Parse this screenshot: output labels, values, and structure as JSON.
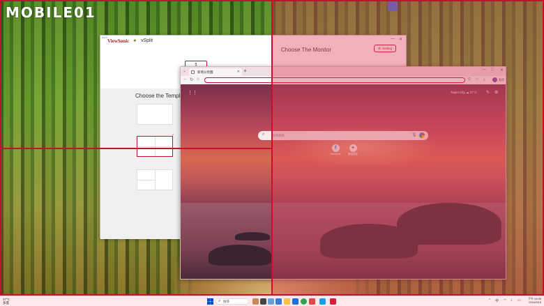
{
  "watermark": {
    "text": "MOBILE01"
  },
  "vsplit": {
    "brand": "ViewSonic",
    "app_name": "vSplit",
    "version": "v1.0",
    "choose_monitor": "Choose The Monitor",
    "setting_label": "Setting",
    "monitor_number": "1",
    "choose_template": "Choose the Templat",
    "minimize": "—",
    "close": "✕"
  },
  "browser": {
    "tab_title": "新增分頁籤",
    "weather_city": "Taipei City",
    "weather_temp": "27°C",
    "search_placeholder": "搜尋網頁",
    "shortcuts": [
      {
        "label": "Facebook",
        "icon": "f"
      },
      {
        "label": "新增捷徑",
        "icon": "+"
      }
    ],
    "profile_label": "暫停"
  },
  "taskbar": {
    "weather_temp": "27°C",
    "weather_desc": "多雲",
    "search_label": "搜尋",
    "time": "下午 04:35",
    "date": "2024/5/15",
    "lang": "中"
  },
  "colors": {
    "accent_red": "#c8102e",
    "zone_overlay": "rgba(220,70,90,0.42)"
  }
}
